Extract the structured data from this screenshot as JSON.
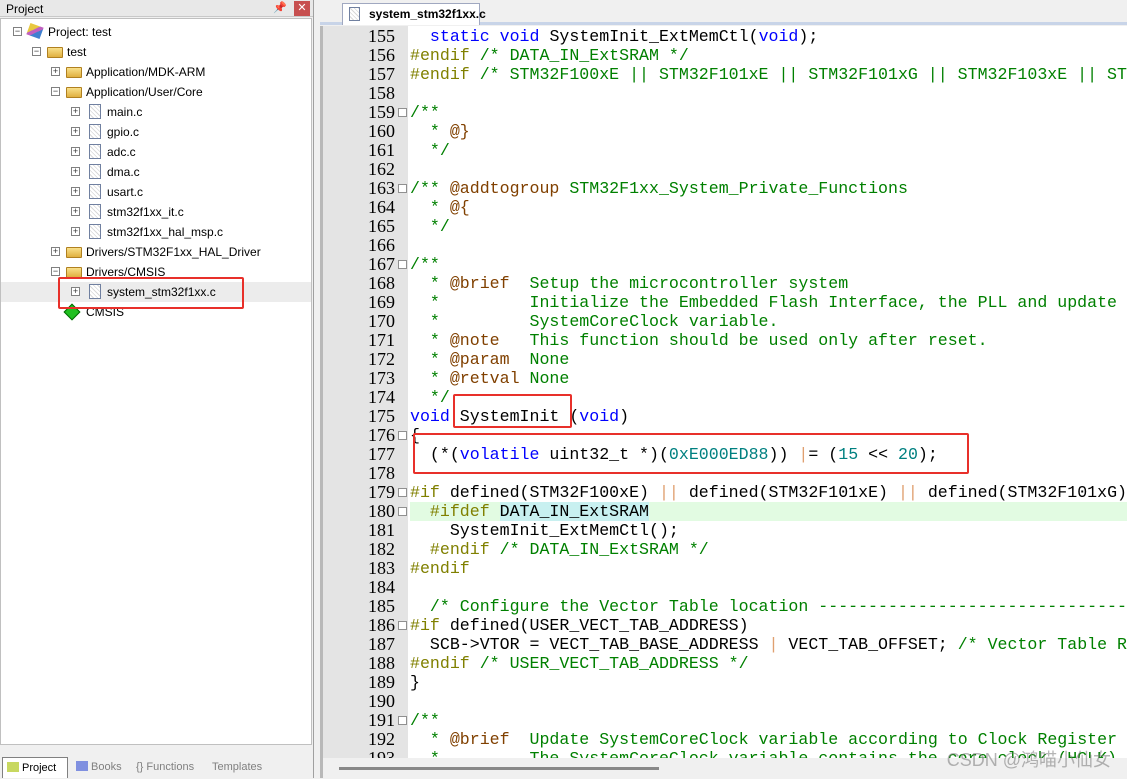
{
  "project_panel": {
    "title": "Project",
    "pin_icon": "pin-icon",
    "close_icon": "close-icon",
    "tree": [
      {
        "label": "Project: test",
        "icon": "project-icon",
        "level": 0,
        "expander": "-"
      },
      {
        "label": "test",
        "icon": "target-folder-icon",
        "level": 1,
        "expander": "-"
      },
      {
        "label": "Application/MDK-ARM",
        "icon": "folder-icon",
        "level": 2,
        "expander": "+"
      },
      {
        "label": "Application/User/Core",
        "icon": "folder-open-icon",
        "level": 2,
        "expander": "-"
      },
      {
        "label": "main.c",
        "icon": "file-icon",
        "level": 3,
        "expander": "+"
      },
      {
        "label": "gpio.c",
        "icon": "file-icon",
        "level": 3,
        "expander": "+"
      },
      {
        "label": "adc.c",
        "icon": "file-icon",
        "level": 3,
        "expander": "+"
      },
      {
        "label": "dma.c",
        "icon": "file-icon",
        "level": 3,
        "expander": "+"
      },
      {
        "label": "usart.c",
        "icon": "file-icon",
        "level": 3,
        "expander": "+"
      },
      {
        "label": "stm32f1xx_it.c",
        "icon": "file-icon",
        "level": 3,
        "expander": "+"
      },
      {
        "label": "stm32f1xx_hal_msp.c",
        "icon": "file-icon",
        "level": 3,
        "expander": "+"
      },
      {
        "label": "Drivers/STM32F1xx_HAL_Driver",
        "icon": "folder-icon",
        "level": 2,
        "expander": "+"
      },
      {
        "label": "Drivers/CMSIS",
        "icon": "folder-open-icon",
        "level": 2,
        "expander": "-"
      },
      {
        "label": "system_stm32f1xx.c",
        "icon": "file-icon",
        "level": 3,
        "expander": "+",
        "selected": true
      },
      {
        "label": "CMSIS",
        "icon": "cmsis-icon",
        "level": 2,
        "expander": ""
      }
    ],
    "bottom_tabs": [
      {
        "label": "Project",
        "icon": "project-tab-icon",
        "active": true
      },
      {
        "label": "Books",
        "icon": "books-icon"
      },
      {
        "label": "{} Functions",
        "icon": "functions-icon"
      },
      {
        "label": "Templates",
        "icon": "templates-icon"
      }
    ]
  },
  "editor": {
    "tab": "system_stm32f1xx.c",
    "lines": [
      {
        "n": "155",
        "t": [
          [
            "x",
            "  "
          ],
          [
            "k",
            "static"
          ],
          [
            "x",
            " "
          ],
          [
            "k",
            "void"
          ],
          [
            "x",
            " SystemInit_ExtMemCtl("
          ],
          [
            "k",
            "void"
          ],
          [
            "x",
            ");"
          ]
        ]
      },
      {
        "n": "156",
        "t": [
          [
            "p",
            "#endif"
          ],
          [
            "c",
            " /* DATA_IN_ExtSRAM */"
          ]
        ]
      },
      {
        "n": "157",
        "t": [
          [
            "p",
            "#endif"
          ],
          [
            "c",
            " /* STM32F100xE || STM32F101xE || STM32F101xG || STM32F103xE || ST"
          ]
        ]
      },
      {
        "n": "158",
        "t": []
      },
      {
        "n": "159",
        "fold": true,
        "t": [
          [
            "c",
            "/**"
          ]
        ]
      },
      {
        "n": "160",
        "t": [
          [
            "c",
            "  * "
          ],
          [
            "t",
            "@}"
          ]
        ]
      },
      {
        "n": "161",
        "t": [
          [
            "c",
            "  */"
          ]
        ]
      },
      {
        "n": "162",
        "t": []
      },
      {
        "n": "163",
        "fold": true,
        "t": [
          [
            "c",
            "/** "
          ],
          [
            "t",
            "@addtogroup"
          ],
          [
            "c",
            " STM32F1xx_System_Private_Functions"
          ]
        ]
      },
      {
        "n": "164",
        "t": [
          [
            "c",
            "  * "
          ],
          [
            "t",
            "@{"
          ]
        ]
      },
      {
        "n": "165",
        "t": [
          [
            "c",
            "  */"
          ]
        ]
      },
      {
        "n": "166",
        "t": []
      },
      {
        "n": "167",
        "fold": true,
        "t": [
          [
            "c",
            "/**"
          ]
        ]
      },
      {
        "n": "168",
        "t": [
          [
            "c",
            "  * "
          ],
          [
            "t",
            "@brief"
          ],
          [
            "c",
            "  Setup the microcontroller system"
          ]
        ]
      },
      {
        "n": "169",
        "t": [
          [
            "c",
            "  *         Initialize the Embedded Flash Interface, the PLL and update the"
          ]
        ]
      },
      {
        "n": "170",
        "t": [
          [
            "c",
            "  *         SystemCoreClock variable."
          ]
        ]
      },
      {
        "n": "171",
        "t": [
          [
            "c",
            "  * "
          ],
          [
            "t",
            "@note"
          ],
          [
            "c",
            "   This function should be used only after reset."
          ]
        ]
      },
      {
        "n": "172",
        "t": [
          [
            "c",
            "  * "
          ],
          [
            "t",
            "@param"
          ],
          [
            "c",
            "  None"
          ]
        ]
      },
      {
        "n": "173",
        "t": [
          [
            "c",
            "  * "
          ],
          [
            "t",
            "@retval"
          ],
          [
            "c",
            " None"
          ]
        ]
      },
      {
        "n": "174",
        "t": [
          [
            "c",
            "  */"
          ]
        ]
      },
      {
        "n": "175",
        "t": [
          [
            "k",
            "void"
          ],
          [
            "x",
            " SystemInit ("
          ],
          [
            "k",
            "void"
          ],
          [
            "x",
            ")"
          ]
        ]
      },
      {
        "n": "176",
        "fold": true,
        "t": [
          [
            "x",
            "{"
          ]
        ]
      },
      {
        "n": "177",
        "t": [
          [
            "x",
            "  (*("
          ],
          [
            "k",
            "volatile"
          ],
          [
            "x",
            " uint32_t *)("
          ],
          [
            "n",
            "0xE000ED88"
          ],
          [
            "x",
            ")) "
          ],
          [
            "o",
            "|"
          ],
          [
            "x",
            "= ("
          ],
          [
            "n",
            "15"
          ],
          [
            "x",
            " << "
          ],
          [
            "n",
            "20"
          ],
          [
            "x",
            ");"
          ]
        ]
      },
      {
        "n": "178",
        "t": []
      },
      {
        "n": "179",
        "fold": true,
        "t": [
          [
            "p",
            "#if"
          ],
          [
            "x",
            " defined(STM32F100xE) "
          ],
          [
            "o",
            "||"
          ],
          [
            "x",
            " defined(STM32F101xE) "
          ],
          [
            "o",
            "||"
          ],
          [
            "x",
            " defined(STM32F101xG) "
          ],
          [
            "o",
            "||"
          ]
        ]
      },
      {
        "n": "180",
        "fold": true,
        "hl": true,
        "t": [
          [
            "x",
            "  "
          ],
          [
            "p",
            "#ifdef"
          ],
          [
            "x",
            " "
          ],
          [
            "s",
            "DATA_IN_ExtSRAM"
          ]
        ]
      },
      {
        "n": "181",
        "t": [
          [
            "x",
            "    SystemInit_ExtMemCtl();"
          ]
        ]
      },
      {
        "n": "182",
        "t": [
          [
            "x",
            "  "
          ],
          [
            "p",
            "#endif"
          ],
          [
            "c",
            " /* DATA_IN_ExtSRAM */"
          ]
        ]
      },
      {
        "n": "183",
        "t": [
          [
            "p",
            "#endif"
          ]
        ]
      },
      {
        "n": "184",
        "t": []
      },
      {
        "n": "185",
        "t": [
          [
            "c",
            "  /* Configure the Vector Table location -------------------------------------------"
          ]
        ]
      },
      {
        "n": "186",
        "fold": true,
        "t": [
          [
            "p",
            "#if"
          ],
          [
            "x",
            " defined(USER_VECT_TAB_ADDRESS)"
          ]
        ]
      },
      {
        "n": "187",
        "t": [
          [
            "x",
            "  SCB->VTOR = VECT_TAB_BASE_ADDRESS "
          ],
          [
            "o",
            "|"
          ],
          [
            "x",
            " VECT_TAB_OFFSET; "
          ],
          [
            "c",
            "/* Vector Table Relocation"
          ]
        ]
      },
      {
        "n": "188",
        "t": [
          [
            "p",
            "#endif"
          ],
          [
            "c",
            " /* USER_VECT_TAB_ADDRESS */"
          ]
        ]
      },
      {
        "n": "189",
        "t": [
          [
            "x",
            "}"
          ]
        ]
      },
      {
        "n": "190",
        "t": []
      },
      {
        "n": "191",
        "fold": true,
        "t": [
          [
            "c",
            "/**"
          ]
        ]
      },
      {
        "n": "192",
        "t": [
          [
            "c",
            "  * "
          ],
          [
            "t",
            "@brief"
          ],
          [
            "c",
            "  Update SystemCoreClock variable according to Clock Register Values."
          ]
        ]
      },
      {
        "n": "193",
        "t": [
          [
            "c",
            "  *         The SystemCoreClock variable contains the core clock (HCLK)"
          ]
        ]
      }
    ]
  },
  "watermark": "CSDN @鸿喵小仙女",
  "colors": {
    "keyword": "#0000ff",
    "comment": "#008000",
    "preprocessor": "#808000",
    "doc_tag": "#804000",
    "number": "#008080",
    "highlight_box": "#e8302a",
    "current_line": "#e2fbe2"
  }
}
